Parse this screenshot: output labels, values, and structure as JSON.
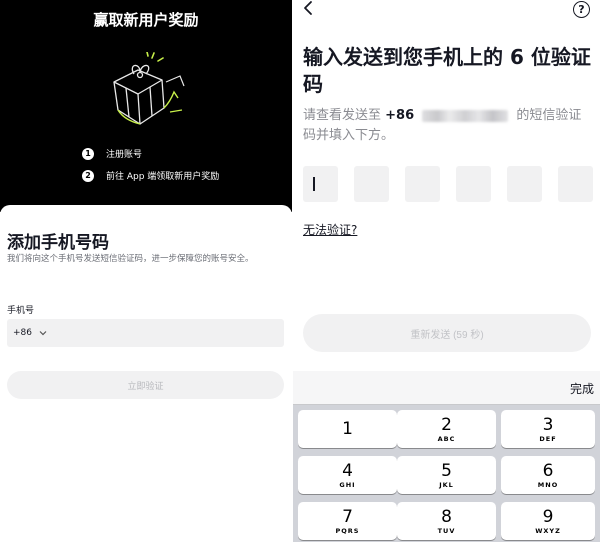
{
  "left_screen": {
    "promo": {
      "title": "赢取新用户奖励",
      "steps": [
        {
          "num": "1",
          "text": "注册账号"
        },
        {
          "num": "2",
          "text": "前往 App 端领取新用户奖励"
        }
      ]
    },
    "sheet": {
      "title": "添加手机号码",
      "description": "我们将向这个手机号发送短信验证码，进一步保障您的账号安全。",
      "phone_label": "手机号",
      "country_code": "+86",
      "phone_value": "",
      "verify_button": "立即验证"
    }
  },
  "right_screen": {
    "title": "输入发送到您手机上的 6 位验证码",
    "desc_prefix": "请查看发送至",
    "desc_code": "+86",
    "desc_suffix": "的短信验证码并填入下方。",
    "cant_verify": "无法验证?",
    "resend_button": "重新发送 (59 秒)",
    "otp_length": 6,
    "keyboard": {
      "done": "完成",
      "keys": [
        {
          "digit": "1",
          "letters": ""
        },
        {
          "digit": "2",
          "letters": "ABC"
        },
        {
          "digit": "3",
          "letters": "DEF"
        },
        {
          "digit": "4",
          "letters": "GHI"
        },
        {
          "digit": "5",
          "letters": "JKL"
        },
        {
          "digit": "6",
          "letters": "MNO"
        },
        {
          "digit": "7",
          "letters": "PQRS"
        },
        {
          "digit": "8",
          "letters": "TUV"
        },
        {
          "digit": "9",
          "letters": "WXYZ"
        }
      ]
    }
  },
  "icons": {
    "back": "chevron-left-icon",
    "help": "question-circle-icon",
    "dropdown": "chevron-down-icon",
    "gift": "gift-box-icon"
  },
  "colors": {
    "promo_bg": "#000000",
    "gift_accent": "#c8f04a",
    "text_primary": "#161823",
    "text_secondary": "#8a8b91",
    "field_bg": "#f1f1f2",
    "keyboard_bg": "#d1d3d9"
  }
}
